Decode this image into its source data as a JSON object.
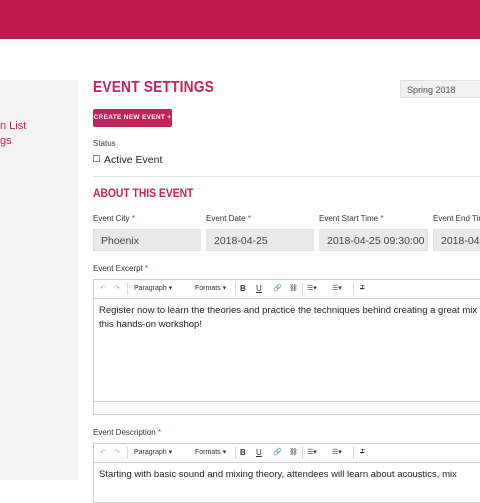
{
  "colors": {
    "brand": "#bd1b4f",
    "accent": "#c0245a",
    "field_bg": "#e7e9ec"
  },
  "sidebar": {
    "items": [
      {
        "label": "n List"
      },
      {
        "label": "gs"
      }
    ]
  },
  "header": {
    "title": "EVENT SETTINGS",
    "season_select": "Spring 2018",
    "create_button": "CREATE NEW EVENT +"
  },
  "status": {
    "label": "Status",
    "checkbox_label": "Active Event"
  },
  "about": {
    "title": "ABOUT THIS EVENT",
    "fields": [
      {
        "label": "Event City",
        "value": "Phoenix"
      },
      {
        "label": "Event Date",
        "value": "2018-04-25"
      },
      {
        "label": "Event Start Time",
        "value": "2018-04-25 09:30:00"
      },
      {
        "label": "Event End Tim",
        "value": "2018-04-"
      }
    ],
    "required_mark": "*"
  },
  "toolbar": {
    "undo_icon": "↶",
    "redo_icon": "↷",
    "paragraph": "Paragraph",
    "formats": "Formats",
    "bold": "B",
    "underline": "U",
    "link_icon": "🔗",
    "unlink_icon": "⛓",
    "bullets_icon": "☰",
    "numbers_icon": "☰",
    "clear_icon": "T",
    "caret": "▾"
  },
  "excerpt": {
    "label": "Event Excerpt",
    "text": "Register now to learn the theories and practice the techniques behind creating a great mix in this hands-on workshop!"
  },
  "description": {
    "label": "Event Description",
    "text": "Starting with basic sound and mixing theory, attendees will learn about acoustics, mix"
  }
}
